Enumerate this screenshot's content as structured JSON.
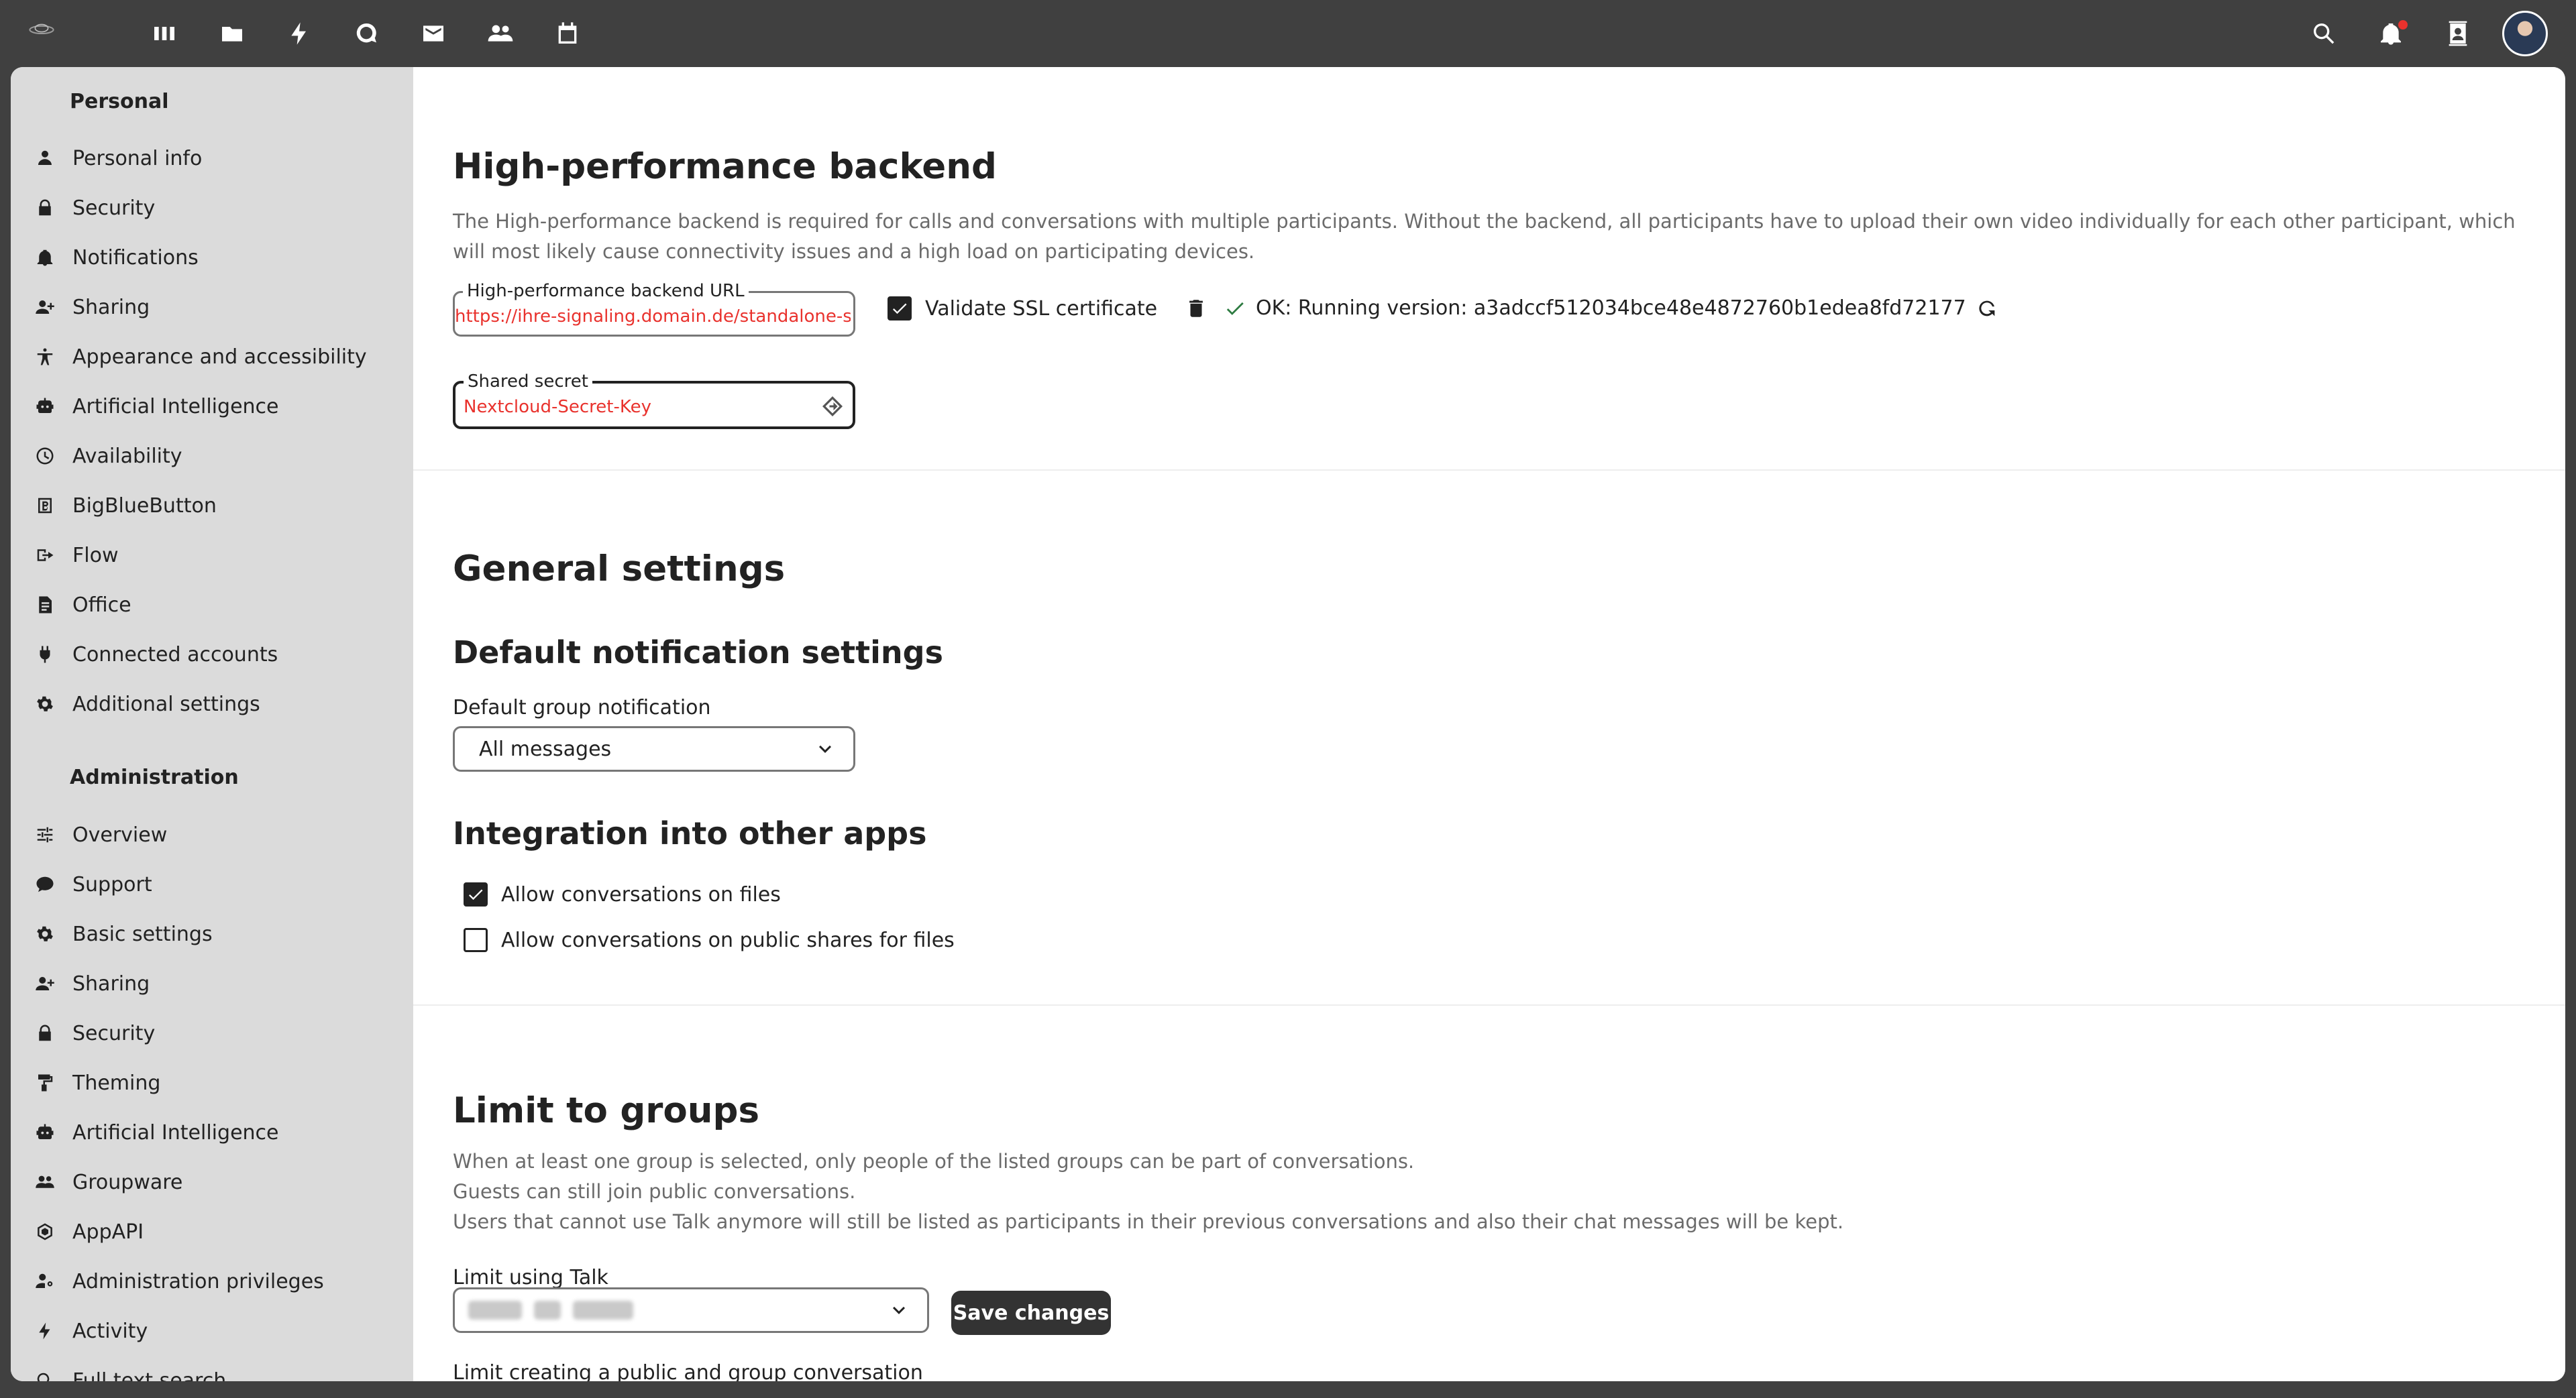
{
  "header": {
    "apps": [
      "dashboard-icon",
      "files-icon",
      "activity-icon",
      "talk-icon",
      "mail-icon",
      "contacts-icon",
      "calendar-icon"
    ],
    "right": [
      "search-icon",
      "bell-icon",
      "contacts-menu-icon",
      "avatar"
    ]
  },
  "sidebar": {
    "personal_heading": "Personal",
    "personal_items": [
      {
        "label": "Personal info",
        "icon": "user-icon"
      },
      {
        "label": "Security",
        "icon": "lock-icon"
      },
      {
        "label": "Notifications",
        "icon": "bell-icon"
      },
      {
        "label": "Sharing",
        "icon": "share-icon"
      },
      {
        "label": "Appearance and accessibility",
        "icon": "accessibility-icon"
      },
      {
        "label": "Artificial Intelligence",
        "icon": "robot-icon"
      },
      {
        "label": "Availability",
        "icon": "clock-icon"
      },
      {
        "label": "BigBlueButton",
        "icon": "bbb-icon"
      },
      {
        "label": "Flow",
        "icon": "flow-icon"
      },
      {
        "label": "Office",
        "icon": "document-icon"
      },
      {
        "label": "Connected accounts",
        "icon": "plug-icon"
      },
      {
        "label": "Additional settings",
        "icon": "gear-icon"
      }
    ],
    "admin_heading": "Administration",
    "admin_items": [
      {
        "label": "Overview",
        "icon": "sliders-icon"
      },
      {
        "label": "Support",
        "icon": "chat-icon"
      },
      {
        "label": "Basic settings",
        "icon": "gear-icon"
      },
      {
        "label": "Sharing",
        "icon": "share-icon"
      },
      {
        "label": "Security",
        "icon": "lock-icon"
      },
      {
        "label": "Theming",
        "icon": "paint-roller-icon"
      },
      {
        "label": "Artificial Intelligence",
        "icon": "robot-icon"
      },
      {
        "label": "Groupware",
        "icon": "group-icon"
      },
      {
        "label": "AppAPI",
        "icon": "appapi-icon"
      },
      {
        "label": "Administration privileges",
        "icon": "admin-user-icon"
      },
      {
        "label": "Activity",
        "icon": "activity-icon"
      },
      {
        "label": "Full text search",
        "icon": "search-icon"
      }
    ]
  },
  "hpb": {
    "title": "High-performance backend",
    "description": "The High-performance backend is required for calls and conversations with multiple participants. Without the backend, all participants have to upload their own video individually for each other participant, which will most likely cause connectivity issues and a high load on participating devices.",
    "url_label": "High-performance backend URL",
    "url_value": "https://ihre-signaling.domain.de/standalone-signaling/",
    "validate_ssl_label": "Validate SSL certificate",
    "validate_ssl_checked": true,
    "status_text": "OK: Running version: a3adccf512034bce48e4872760b1edea8fd72177",
    "secret_label": "Shared secret",
    "secret_value": "Nextcloud-Secret-Key"
  },
  "general": {
    "title": "General settings",
    "notif_title": "Default notification settings",
    "group_notif_label": "Default group notification",
    "group_notif_value": "All messages",
    "integration_title": "Integration into other apps",
    "allow_files_label": "Allow conversations on files",
    "allow_files_checked": true,
    "allow_public_label": "Allow conversations on public shares for files",
    "allow_public_checked": false
  },
  "limit": {
    "title": "Limit to groups",
    "line1": "When at least one group is selected, only people of the listed groups can be part of conversations.",
    "line2": "Guests can still join public conversations.",
    "line3": "Users that cannot use Talk anymore will still be listed as participants in their previous conversations and also their chat messages will be kept.",
    "using_label": "Limit using Talk",
    "save_label": "Save changes",
    "creating_label": "Limit creating a public and group conversation"
  },
  "colors": {
    "header": "#404040",
    "sidebar": "#dbdbdb",
    "error_text": "#e9322d",
    "ok_green": "#2d7b41"
  }
}
